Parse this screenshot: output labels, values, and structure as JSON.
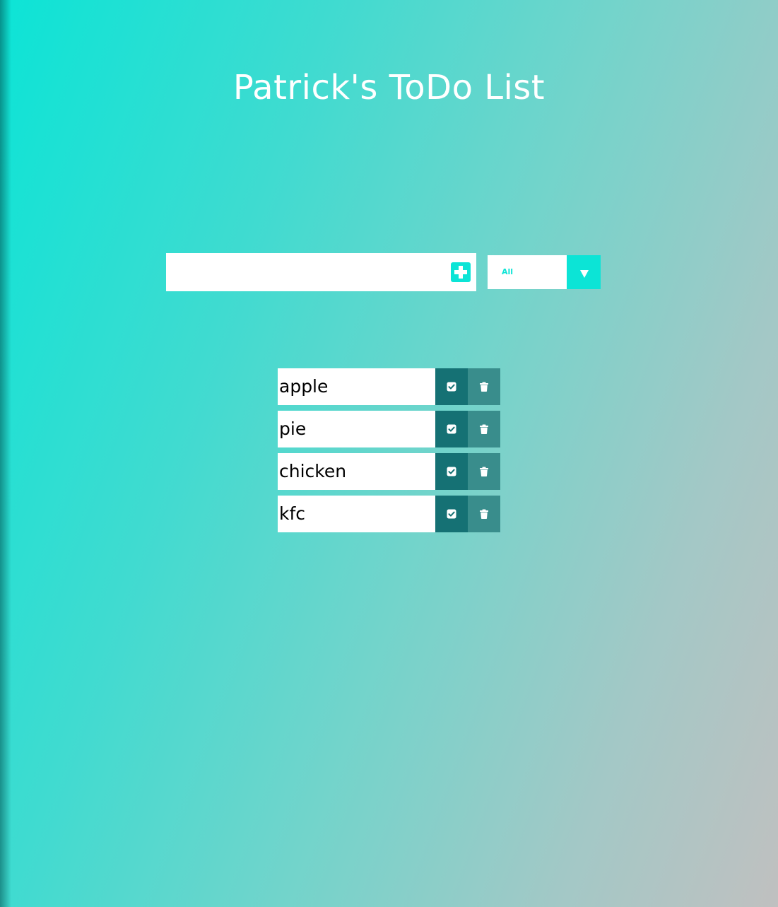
{
  "app": {
    "title": "Patrick's ToDo List"
  },
  "form": {
    "input_value": "",
    "input_placeholder": "",
    "add_icon": "plus-square-icon"
  },
  "filter": {
    "selected": "All",
    "arrow_icon": "caret-down-icon"
  },
  "todos": [
    {
      "text": "apple",
      "complete_icon": "check-square-icon",
      "delete_icon": "trash-icon"
    },
    {
      "text": "pie",
      "complete_icon": "check-square-icon",
      "delete_icon": "trash-icon"
    },
    {
      "text": "chicken",
      "complete_icon": "check-square-icon",
      "delete_icon": "trash-icon"
    },
    {
      "text": "kfc",
      "complete_icon": "check-square-icon",
      "delete_icon": "trash-icon"
    }
  ],
  "colors": {
    "accent": "#0ce4d6",
    "complete_button": "#157174",
    "delete_button": "#398d8c",
    "gradient_end": "#c0c0c0"
  }
}
